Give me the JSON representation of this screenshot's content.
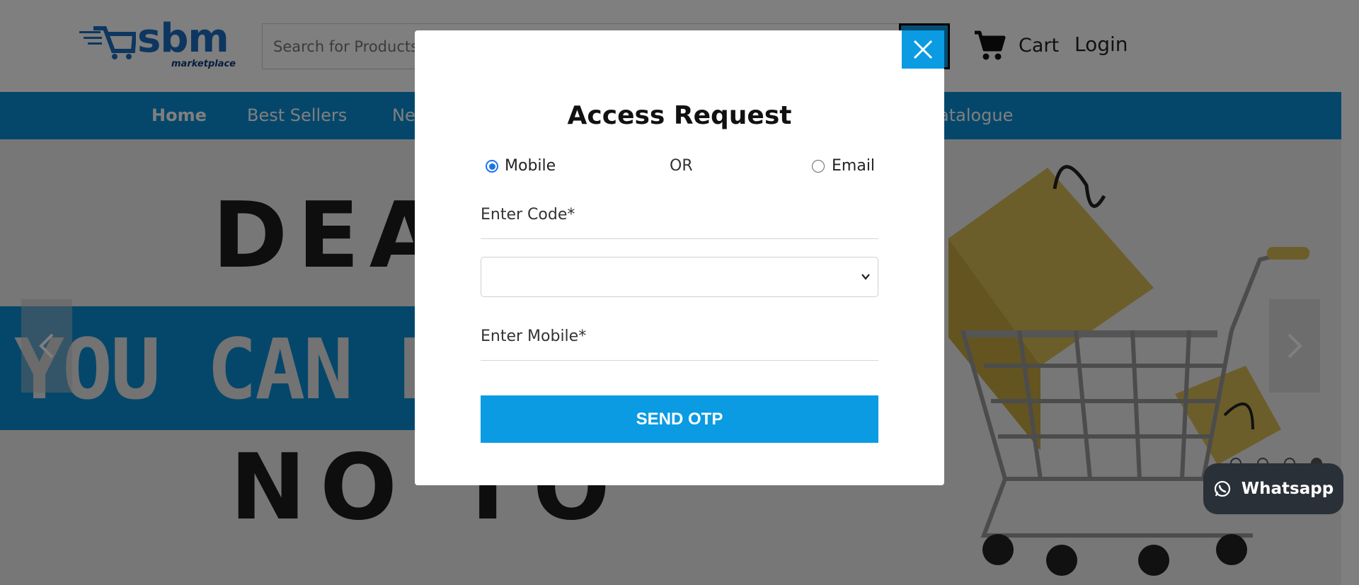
{
  "header": {
    "logo_text": "sbm",
    "logo_sub": "marketplace",
    "search_placeholder": "Search for Products",
    "cart_label": "Cart",
    "login_label": "Login"
  },
  "nav": {
    "items": [
      "Home",
      "Best Sellers",
      "Ne",
      "atalogue"
    ]
  },
  "banner": {
    "line1": "DEA",
    "line2": "YOU CAN N",
    "line3": "NO TO",
    "slide_count": 4,
    "active_slide": 4
  },
  "whatsapp_label": "Whatsapp",
  "modal": {
    "title": "Access Request",
    "option_mobile": "Mobile",
    "option_or": "OR",
    "option_email": "Email",
    "selected_option": "Mobile",
    "code_label": "Enter Code*",
    "code_value": "",
    "mobile_label": "Enter Mobile*",
    "send_label": "SEND OTP"
  },
  "colors": {
    "accent": "#0a9be3",
    "nav_bg": "#0a8fd6",
    "radio_checked": "#1a73e8"
  }
}
